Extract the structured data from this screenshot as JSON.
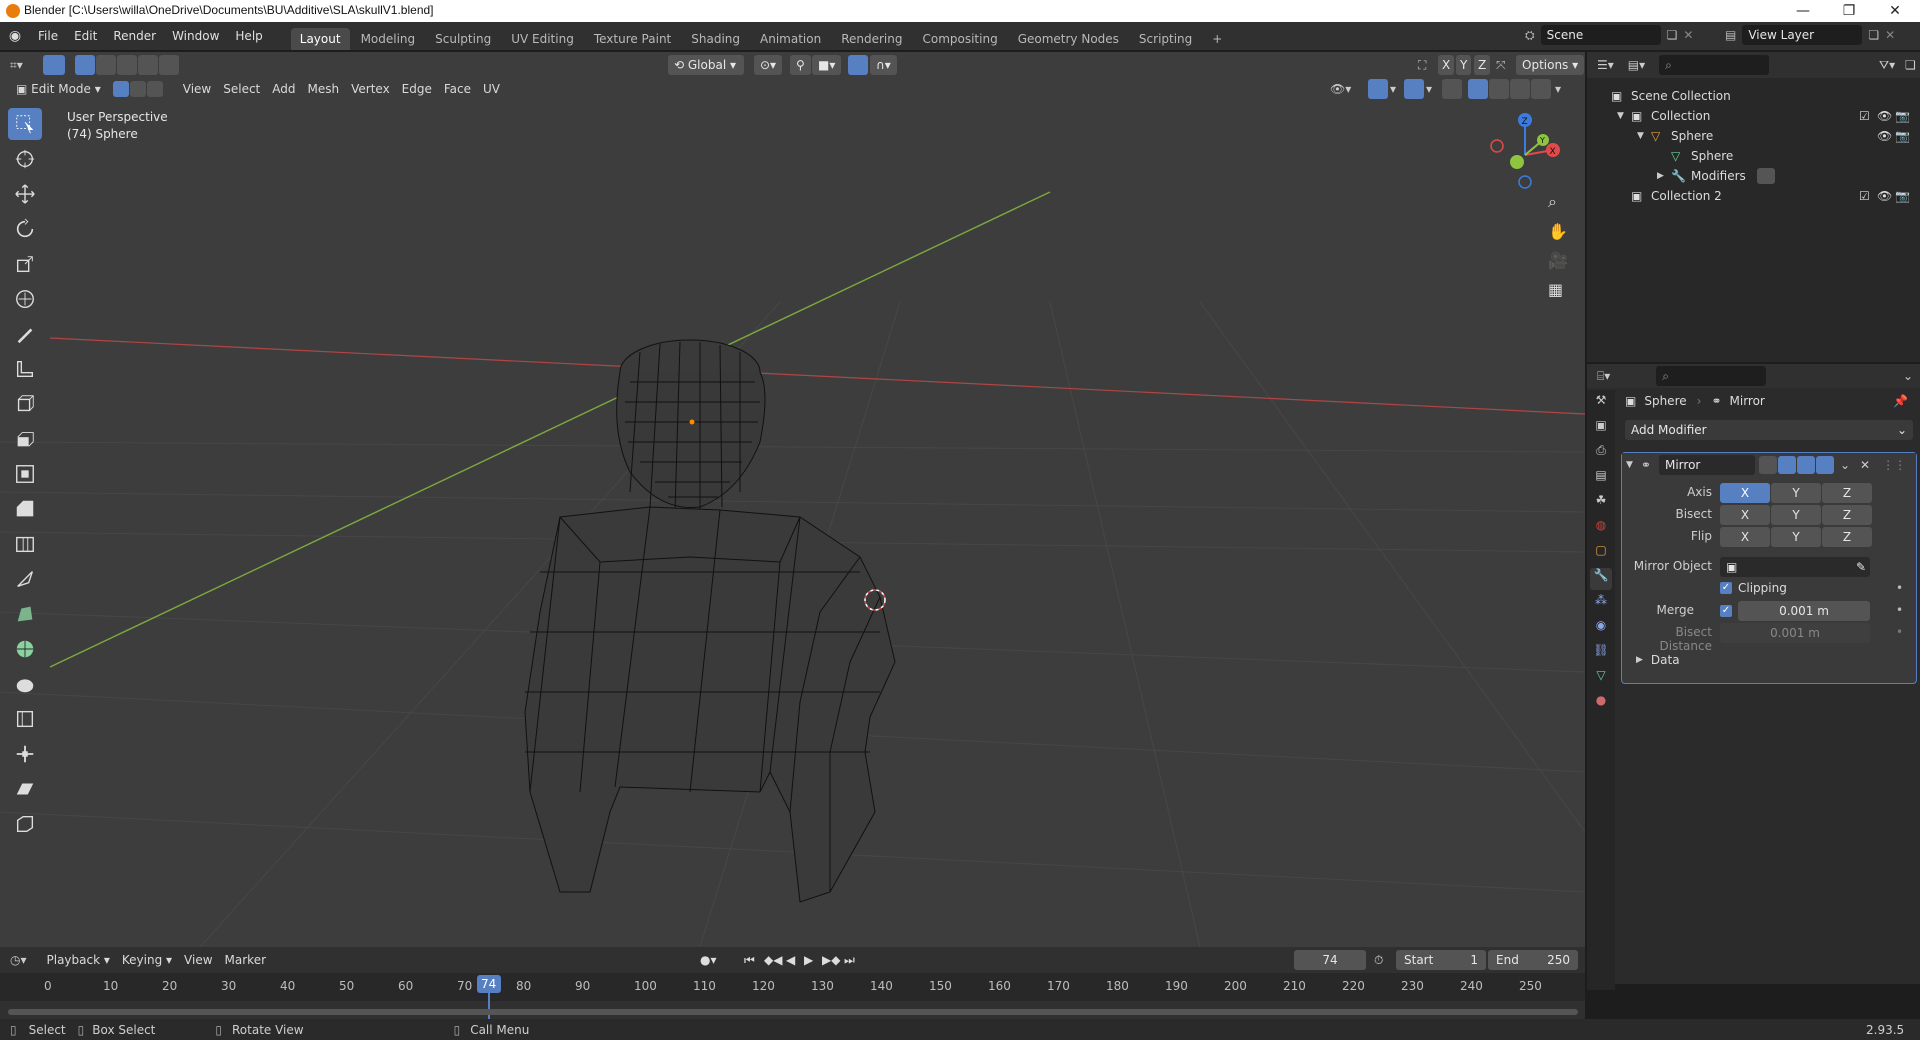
{
  "window": {
    "title": "Blender [C:\\Users\\willa\\OneDrive\\Documents\\BU\\Additive\\SLA\\skullV1.blend]",
    "controls": [
      "—",
      "❐",
      "✕"
    ]
  },
  "menu": [
    "File",
    "Edit",
    "Render",
    "Window",
    "Help"
  ],
  "workspaces": [
    "Layout",
    "Modeling",
    "Sculpting",
    "UV Editing",
    "Texture Paint",
    "Shading",
    "Animation",
    "Rendering",
    "Compositing",
    "Geometry Nodes",
    "Scripting"
  ],
  "active_workspace": "Layout",
  "scene": "Scene",
  "view_layer": "View Layer",
  "viewport": {
    "mode": "Edit Mode",
    "menus": [
      "View",
      "Select",
      "Add",
      "Mesh",
      "Vertex",
      "Edge",
      "Face",
      "UV"
    ],
    "transform_orientation": "Global",
    "options_label": "Options",
    "axis_xyz": [
      "X",
      "Y",
      "Z"
    ],
    "overlay_text_line1": "User Perspective",
    "overlay_text_line2": "(74) Sphere",
    "gizmo_labels": [
      "Z",
      "Y",
      "X"
    ]
  },
  "outliner": {
    "rows": [
      {
        "label": "Scene Collection",
        "indent": 0
      },
      {
        "label": "Collection",
        "indent": 1
      },
      {
        "label": "Sphere",
        "indent": 2
      },
      {
        "label": "Sphere",
        "indent": 3
      },
      {
        "label": "Modifiers",
        "indent": 3
      },
      {
        "label": "Collection 2",
        "indent": 1
      }
    ]
  },
  "properties": {
    "breadcrumb_object": "Sphere",
    "breadcrumb_modifier": "Mirror",
    "add_modifier": "Add Modifier",
    "modifier_name": "Mirror",
    "axis_label": "Axis",
    "bisect_label": "Bisect",
    "flip_label": "Flip",
    "xyz": [
      "X",
      "Y",
      "Z"
    ],
    "mirror_object_label": "Mirror Object",
    "clipping_label": "Clipping",
    "merge_label": "Merge",
    "merge_value": "0.001 m",
    "bisect_distance_label": "Bisect Distance",
    "bisect_distance_value": "0.001 m",
    "data_label": "Data"
  },
  "timeline": {
    "menus": [
      "Playback",
      "Keying",
      "View",
      "Marker"
    ],
    "current_frame": "74",
    "start_label": "Start",
    "start_value": "1",
    "end_label": "End",
    "end_value": "250",
    "ticks": [
      "0",
      "10",
      "20",
      "30",
      "40",
      "50",
      "60",
      "70",
      "80",
      "90",
      "100",
      "110",
      "120",
      "130",
      "140",
      "150",
      "160",
      "170",
      "180",
      "190",
      "200",
      "210",
      "220",
      "230",
      "240",
      "250"
    ],
    "playhead": "74"
  },
  "status": {
    "select": "Select",
    "box_select": "Box Select",
    "rotate_view": "Rotate View",
    "call_menu": "Call Menu",
    "version": "2.93.5"
  },
  "colors": {
    "accent": "#5680c2",
    "x_axis": "#e04a4a",
    "y_axis": "#8ec440",
    "z_axis": "#3c7ce0",
    "viewport_bg": "#3d3d3d",
    "wire": "#111111"
  }
}
